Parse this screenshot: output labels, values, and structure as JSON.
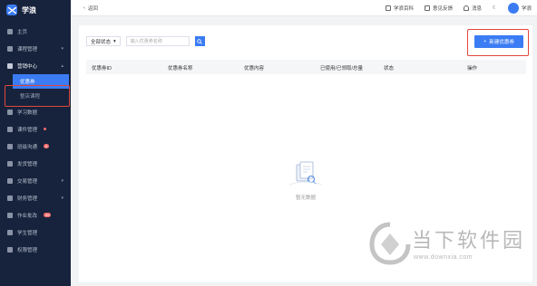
{
  "brand": {
    "name": "学浪"
  },
  "sidebar": {
    "items": [
      {
        "label": "主页",
        "icon": "home-icon"
      },
      {
        "label": "课程管理",
        "icon": "course-icon"
      },
      {
        "label": "营销中心",
        "icon": "marketing-icon"
      },
      {
        "label": "优惠券",
        "icon": ""
      },
      {
        "label": "整店课程",
        "icon": ""
      },
      {
        "label": "学习数据",
        "icon": "data-icon"
      },
      {
        "label": "课件管理",
        "icon": "courseware-icon"
      },
      {
        "label": "班级沟通",
        "icon": "chat-icon",
        "badge": "6"
      },
      {
        "label": "发货管理",
        "icon": "delivery-icon"
      },
      {
        "label": "交易管理",
        "icon": "trade-icon"
      },
      {
        "label": "财务管理",
        "icon": "finance-icon"
      },
      {
        "label": "作业批改",
        "icon": "homework-icon",
        "badge": "99"
      },
      {
        "label": "学生管理",
        "icon": "student-icon"
      },
      {
        "label": "权限管理",
        "icon": "permission-icon"
      }
    ]
  },
  "topbar": {
    "back_label": "返回",
    "links": [
      "学浪百科",
      "意见反馈",
      "消息"
    ],
    "user_name": "学浪"
  },
  "filter": {
    "status_label": "全部状态",
    "search_placeholder": "输入优惠券名称"
  },
  "actions": {
    "create_label": "新建优惠券"
  },
  "table": {
    "columns": [
      "优惠券ID",
      "优惠券名称",
      "优惠内容",
      "已使用/已领取/总量",
      "状态",
      "操作"
    ]
  },
  "empty": {
    "text": "暂无数据"
  },
  "watermark": {
    "title": "当下软件园",
    "url": "www.downxia.com"
  },
  "colors": {
    "primary": "#3b7cf4",
    "sidebar": "#17233d",
    "highlight": "#e0473d"
  }
}
